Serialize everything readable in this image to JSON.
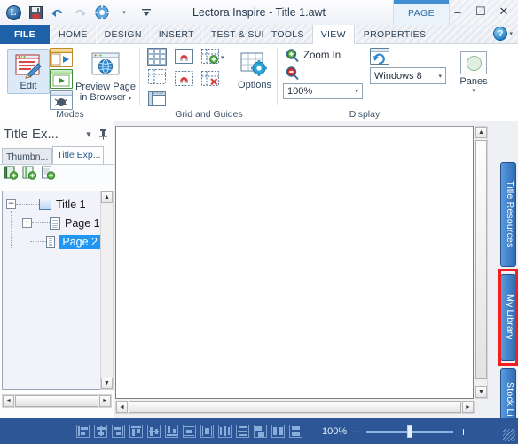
{
  "window": {
    "title": "Lectora Inspire - Title 1.awt",
    "contextual_tab": "PAGE",
    "minimize": "–",
    "maximize": "☐",
    "close": "✕"
  },
  "quick_access": {
    "logo": "L",
    "items": [
      {
        "name": "save-icon",
        "label": "Save"
      },
      {
        "name": "undo-icon",
        "label": "Undo"
      },
      {
        "name": "redo-icon",
        "label": "Redo"
      },
      {
        "name": "settings-icon",
        "label": "Settings"
      },
      {
        "name": "customize-caret-icon",
        "label": "▾"
      },
      {
        "name": "overflow-icon",
        "label": "☰"
      }
    ]
  },
  "ribbon_tabs": [
    {
      "label": "FILE",
      "state": "file"
    },
    {
      "label": "HOME",
      "state": "normal"
    },
    {
      "label": "DESIGN",
      "state": "normal"
    },
    {
      "label": "INSERT",
      "state": "normal"
    },
    {
      "label": "TEST & SURV",
      "state": "truncated"
    },
    {
      "label": "TOOLS",
      "state": "normal"
    },
    {
      "label": "VIEW",
      "state": "active"
    },
    {
      "label": "PROPERTIES",
      "state": "normal"
    }
  ],
  "help": {
    "glyph": "?",
    "caret": "▾"
  },
  "ribbon": {
    "groups": [
      {
        "name": "modes",
        "label": "Modes",
        "buttons": [
          {
            "name": "edit-button",
            "label": "Edit"
          },
          {
            "name": "preview-page-in-browser-button",
            "label": "Preview Page\nin Browser",
            "line1": "Preview Page",
            "line2": "in Browser",
            "caret": "▾"
          }
        ],
        "small_icons": [
          {
            "name": "preview-mode-icon"
          },
          {
            "name": "run-mode-icon"
          },
          {
            "name": "debug-mode-icon"
          }
        ]
      },
      {
        "name": "grid-and-guides",
        "label": "Grid and Guides",
        "buttons": [
          {
            "name": "show-grid-icon"
          },
          {
            "name": "snap-to-grid-icon"
          },
          {
            "name": "add-guide-icon",
            "caret": "▾"
          },
          {
            "name": "show-guides-icon"
          },
          {
            "name": "snap-to-guides-icon"
          },
          {
            "name": "delete-guide-icon"
          },
          {
            "name": "show-rulers-icon"
          },
          {
            "name": "grid-options-button",
            "label": "Options"
          }
        ]
      },
      {
        "name": "display",
        "label": "Display",
        "zoom_in_label": "Zoom In",
        "zoom_out_label": "Zoom Out",
        "zoom_value": "100%",
        "zoom_caret": "▾",
        "refresh_label": "Refresh",
        "theme_value": "Windows 8",
        "theme_caret": "▾"
      },
      {
        "name": "panes",
        "label": "",
        "panes_label": "Panes",
        "panes_caret": "▾"
      }
    ]
  },
  "left_pane": {
    "title": "Title Ex...",
    "collapse_caret": "▾",
    "pin_icon": "⚐",
    "tabs": [
      {
        "label": "Thumbn...",
        "active": false,
        "name": "tab-thumbnails"
      },
      {
        "label": "Title Exp...",
        "active": true,
        "name": "tab-title-explorer"
      }
    ],
    "toolbar": [
      {
        "name": "add-chapter-icon"
      },
      {
        "name": "add-section-icon"
      },
      {
        "name": "add-page-icon"
      }
    ],
    "tree": [
      {
        "label": "Title 1",
        "level": 0,
        "expander": "−",
        "icon": "title-book-icon",
        "selected": false
      },
      {
        "label": "Page 1",
        "level": 1,
        "expander": "+",
        "icon": "page-icon",
        "selected": false
      },
      {
        "label": "Page 2",
        "level": 1,
        "expander": "",
        "icon": "page-icon",
        "selected": true
      }
    ]
  },
  "right_tabs": [
    {
      "label": "Title Resources",
      "name": "tab-title-resources",
      "highlighted": false
    },
    {
      "label": "My Library",
      "name": "tab-my-library",
      "highlighted": true
    },
    {
      "label": "Stock Li",
      "name": "tab-stock-library",
      "highlighted": false
    }
  ],
  "scrollbars": {
    "up": "▲",
    "down": "▼",
    "left": "◄",
    "right": "►"
  },
  "statusbar": {
    "align_icons": [
      {
        "name": "align-left-icon"
      },
      {
        "name": "align-center-horizontal-icon"
      },
      {
        "name": "align-right-icon"
      },
      {
        "name": "align-top-icon"
      },
      {
        "name": "align-middle-icon"
      },
      {
        "name": "align-bottom-icon"
      },
      {
        "name": "center-in-page-vertical-icon"
      },
      {
        "name": "center-in-page-horizontal-icon"
      },
      {
        "name": "distribute-horizontal-icon"
      },
      {
        "name": "distribute-vertical-icon"
      },
      {
        "name": "same-size-icon"
      },
      {
        "name": "same-width-icon"
      },
      {
        "name": "same-height-icon"
      }
    ],
    "zoom_value": "100%",
    "zoom_out": "−",
    "zoom_in": "+"
  },
  "colors": {
    "accent_blue": "#1d62a8",
    "status_blue": "#2c5696",
    "selection_blue": "#2196f3",
    "highlight_red": "#f02020",
    "vtab_blue": "#2f6cb5"
  }
}
